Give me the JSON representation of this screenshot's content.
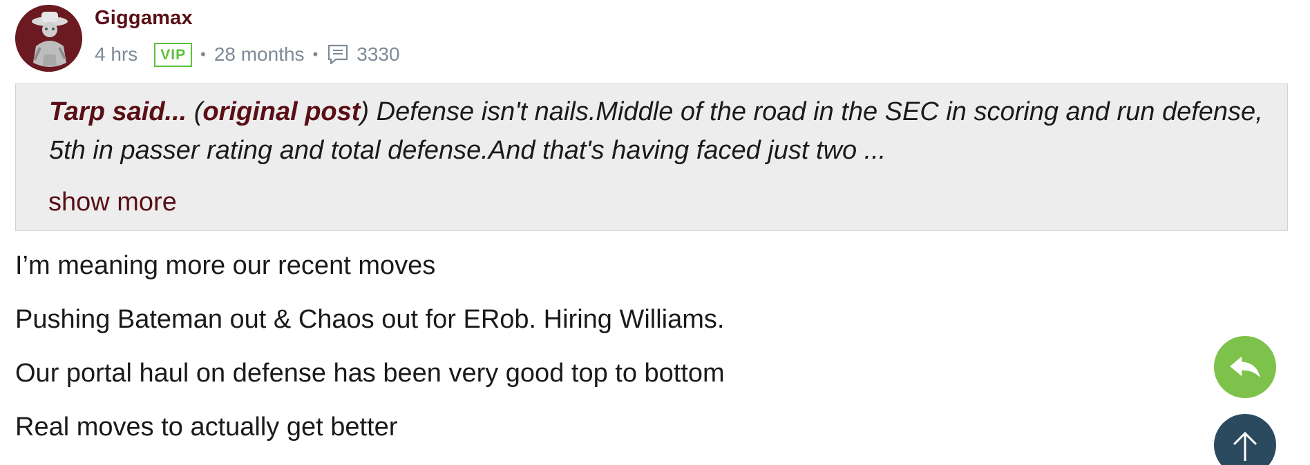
{
  "post": {
    "username": "Giggamax",
    "time": "4 hrs",
    "badge": "VIP",
    "tenure": "28 months",
    "post_count": "3330",
    "avatar_icon": "cowboy-mascot-avatar",
    "comment_icon": "comment-icon"
  },
  "quote": {
    "author": "Tarp said...",
    "open_paren": "(",
    "original_link": "original post",
    "close_paren": ")",
    "text": " Defense isn't nails.Middle of the road in the SEC in scoring and run defense, 5th in passer rating and total defense.And that's having faced just two ...",
    "show_more": "show more"
  },
  "body": {
    "lines": [
      "I’m meaning more our recent moves",
      "Pushing Bateman out & Chaos out for ERob. Hiring Williams.",
      "Our portal haul on defense has been very good top to bottom",
      "Real moves to actually get better"
    ]
  },
  "actions": {
    "reply_icon": "reply-icon",
    "scroll_top_icon": "arrow-up-icon"
  },
  "colors": {
    "brand_maroon": "#5a0f16",
    "vip_green": "#5cc13a",
    "reply_green": "#7dc24b",
    "scroll_navy": "#2c4a5f",
    "quote_bg": "#ededed",
    "meta_gray": "#7d8a96"
  }
}
